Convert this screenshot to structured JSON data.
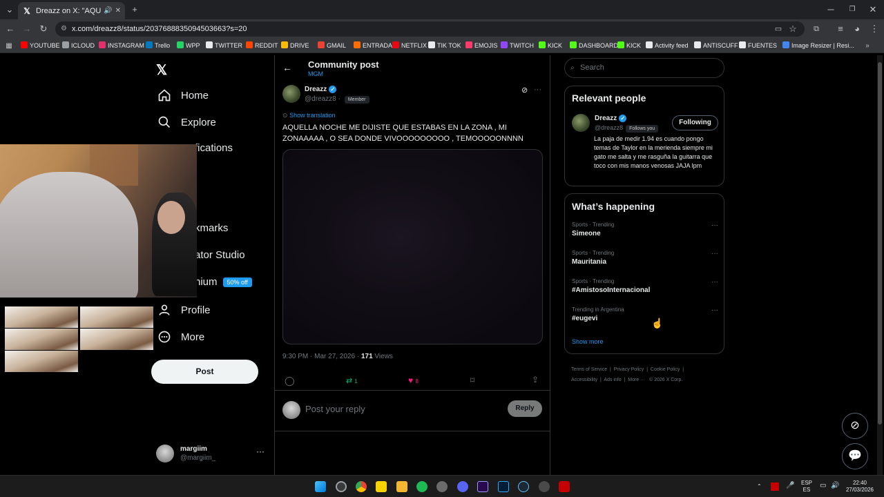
{
  "browser": {
    "tab_title": "Dreazz on X: \"AQUELLA NO",
    "url": "x.com/dreazz8/status/2037688835094503663?s=20",
    "bookmarks": [
      {
        "label": "YOUTUBE",
        "color": "#ff0000"
      },
      {
        "label": "ICLOUD",
        "color": "#9aa0a6"
      },
      {
        "label": "INSTAGRAM",
        "color": "#e1306c"
      },
      {
        "label": "Trello",
        "color": "#0079bf"
      },
      {
        "label": "WPP",
        "color": "#25d366"
      },
      {
        "label": "TWITTER",
        "color": "#e8eaed"
      },
      {
        "label": "REDDIT",
        "color": "#ff4500"
      },
      {
        "label": "DRIVE",
        "color": "#fbbc04"
      },
      {
        "label": "GMAIL",
        "color": "#ea4335"
      },
      {
        "label": "ENTRADA",
        "color": "#ff6d00"
      },
      {
        "label": "NETFLIX",
        "color": "#e50914"
      },
      {
        "label": "TIK TOK",
        "color": "#e8eaed"
      },
      {
        "label": "EMOJIS",
        "color": "#ff3b6b"
      },
      {
        "label": "TWITCH",
        "color": "#9146ff"
      },
      {
        "label": "KICK",
        "color": "#53fc18"
      },
      {
        "label": "DASHBOARD",
        "color": "#53fc18"
      },
      {
        "label": "KICK",
        "color": "#53fc18"
      },
      {
        "label": "Activity feed",
        "color": "#e8eaed"
      },
      {
        "label": "ANTISCUFF",
        "color": "#e8eaed"
      },
      {
        "label": "FUENTES",
        "color": "#e8eaed"
      },
      {
        "label": "Image Resizer | Resi...",
        "color": "#4285f4"
      }
    ]
  },
  "nav": {
    "home": "Home",
    "explore": "Explore",
    "notifications": "fications",
    "bookmarks": "kmarks",
    "creator_studio": "ator Studio",
    "premium": "nium",
    "premium_badge": "50% off",
    "profile": "Profile",
    "more": "More",
    "post": "Post",
    "account_name": "margiim",
    "account_handle": "@margiim_"
  },
  "post": {
    "header_title": "Community post",
    "header_sub": "MGM",
    "author_name": "Dreazz",
    "author_handle": "@dreazz8",
    "member_tag": "Member",
    "show_translation": "Show translation",
    "text": "AQUELLA NOCHE ME DIJISTE QUE ESTABAS EN LA ZONA , MI ZONAAAAA , O SEA DONDE VIVOOOOOOOOO , TEMOOOOONNNN",
    "timestamp": "9:30 PM · Mar 27, 2026 · ",
    "views_count": "171",
    "views_label": " Views",
    "retweets": "1",
    "likes": "8",
    "reply_placeholder": "Post your reply",
    "reply_button": "Reply"
  },
  "sidebar": {
    "search_placeholder": "Search",
    "relevant_title": "Relevant people",
    "person_name": "Dreazz",
    "person_handle": "@dreazz8",
    "follows_you": "Follows you",
    "following_button": "Following",
    "person_bio": "La paja de medir 1.94 es cuando pongo temas de Taylor en la merienda siempre mi gato me salta y me rasguña la guitarra que toco con mis manos venosas JAJA lpm",
    "happening_title": "What’s happening",
    "trends": [
      {
        "meta": "Sports · Trending",
        "name": "Simeone"
      },
      {
        "meta": "Sports · Trending",
        "name": "Mauritania"
      },
      {
        "meta": "Sports · Trending",
        "name": "#AmistosoInternacional"
      },
      {
        "meta": "Trending in Argentina",
        "name": "#eugevi"
      }
    ],
    "show_more": "Show more",
    "footer": {
      "terms": "Terms of Service",
      "privacy": "Privacy Policy",
      "cookie": "Cookie Policy",
      "accessibility": "Accessibility",
      "ads": "Ads info",
      "more": "More ···",
      "copyright": "© 2026 X Corp."
    }
  },
  "taskbar": {
    "lang_top": "ESP",
    "lang_bottom": "ES",
    "time": "22:40",
    "date": "27/03/2026"
  }
}
